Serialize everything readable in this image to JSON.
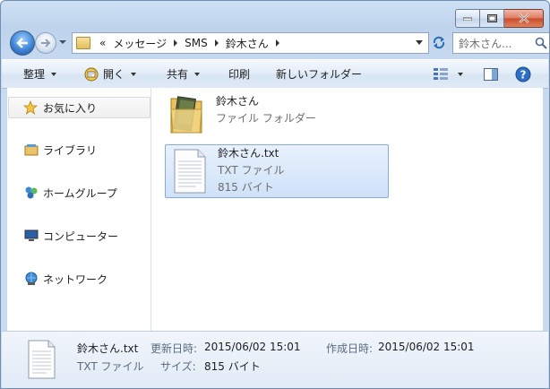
{
  "address": {
    "overflow": "«",
    "crumbs": [
      "メッセージ",
      "SMS",
      "鈴木さん"
    ]
  },
  "search": {
    "placeholder": "鈴木さん..."
  },
  "toolbar": {
    "organize": "整理",
    "open": "開く",
    "share": "共有",
    "print": "印刷",
    "new_folder": "新しいフォルダー"
  },
  "nav": {
    "favorites": "お気に入り",
    "libraries": "ライブラリ",
    "homegroup": "ホームグループ",
    "computer": "コンピューター",
    "network": "ネットワーク"
  },
  "files": [
    {
      "name": "鈴木さん",
      "type": "ファイル フォルダー",
      "size": "",
      "icon": "folder-icon"
    },
    {
      "name": "鈴木さん.txt",
      "type": "TXT ファイル",
      "size": "815 バイト",
      "icon": "text-file-icon"
    }
  ],
  "details": {
    "name": "鈴木さん.txt",
    "type": "TXT ファイル",
    "modified_label": "更新日時:",
    "modified_value": "2015/06/02 15:01",
    "created_label": "作成日時:",
    "created_value": "2015/06/02 15:01",
    "size_label": "サイズ:",
    "size_value": "815 バイト"
  },
  "colors": {
    "selection": "#cfe2f9",
    "window_frame": "#bed3ec"
  }
}
